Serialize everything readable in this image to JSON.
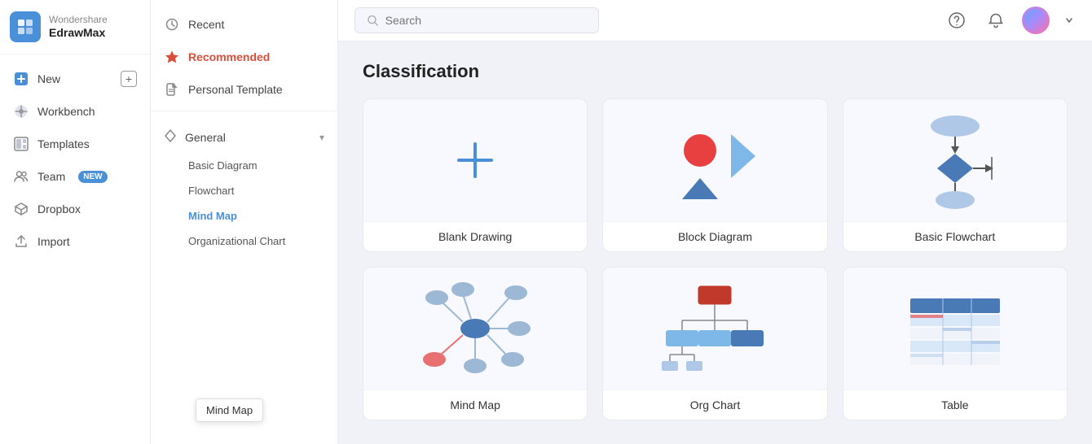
{
  "app": {
    "brand": "Wondershare",
    "product": "EdrawMax"
  },
  "left_nav": {
    "items": [
      {
        "id": "new",
        "label": "New",
        "icon": "plus-circle",
        "has_add": true
      },
      {
        "id": "workbench",
        "label": "Workbench",
        "icon": "grid"
      },
      {
        "id": "templates",
        "label": "Templates",
        "icon": "layout"
      },
      {
        "id": "team",
        "label": "Team",
        "icon": "users",
        "badge": "NEW"
      },
      {
        "id": "dropbox",
        "label": "Dropbox",
        "icon": "box"
      },
      {
        "id": "import",
        "label": "Import",
        "icon": "upload"
      }
    ]
  },
  "second_panel": {
    "items": [
      {
        "id": "recent",
        "label": "Recent",
        "icon": "clock",
        "active": false
      },
      {
        "id": "recommended",
        "label": "Recommended",
        "icon": "star",
        "active": true
      },
      {
        "id": "personal-template",
        "label": "Personal Template",
        "icon": "file",
        "active": false
      }
    ],
    "sections": [
      {
        "id": "general",
        "label": "General",
        "icon": "diamond",
        "expanded": true,
        "sub_items": [
          {
            "id": "basic-diagram",
            "label": "Basic Diagram",
            "active": false
          },
          {
            "id": "flowchart",
            "label": "Flowchart",
            "active": false
          },
          {
            "id": "mind-map",
            "label": "Mind Map",
            "active": true
          },
          {
            "id": "org-chart",
            "label": "Organizational Chart",
            "active": false
          }
        ]
      }
    ]
  },
  "search": {
    "placeholder": "Search"
  },
  "main": {
    "section_title": "Classification",
    "cards": [
      {
        "id": "blank-drawing",
        "label": "Blank Drawing",
        "type": "blank"
      },
      {
        "id": "block-diagram",
        "label": "Block Diagram",
        "type": "block"
      },
      {
        "id": "basic-flowchart",
        "label": "Basic Flowchart",
        "type": "flowchart"
      },
      {
        "id": "mind-map-card",
        "label": "Mind Map",
        "type": "mindmap"
      },
      {
        "id": "org-chart-card",
        "label": "Org Chart",
        "type": "org"
      },
      {
        "id": "table-card",
        "label": "Table",
        "type": "table"
      }
    ]
  },
  "tooltip": {
    "text": "Mind Map"
  }
}
